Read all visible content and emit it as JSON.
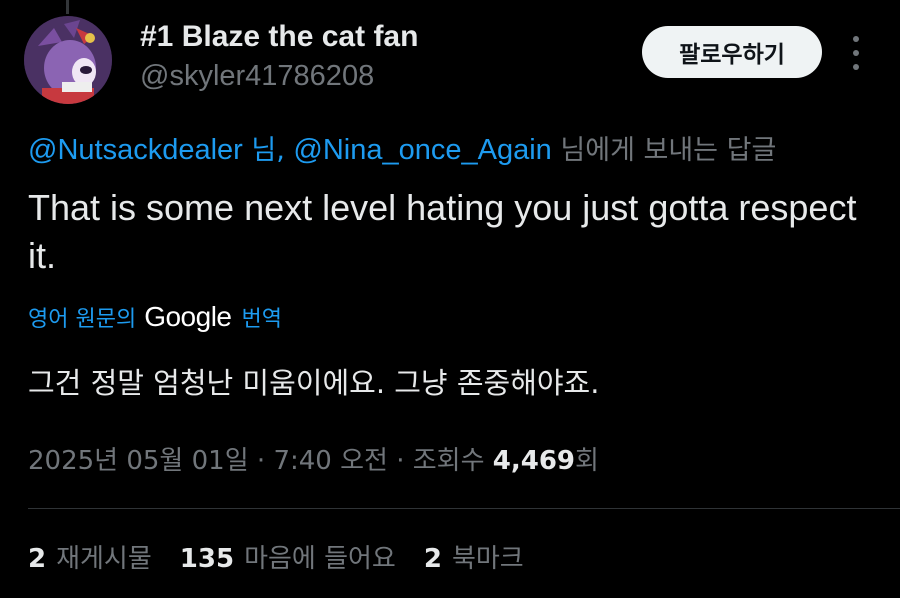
{
  "author": {
    "display_name": "#1 Blaze the cat fan",
    "handle": "@skyler41786208"
  },
  "header": {
    "follow_label": "팔로우하기",
    "more_icon": "more-vertical-icon"
  },
  "reply": {
    "mention1": "@Nutsackdealer",
    "suffix1": " 님, ",
    "mention2": "@Nina_once_Again",
    "suffix2": " 님에게 보내는 답글"
  },
  "tweet": {
    "text": "That is some next level hating you just gotta respect it."
  },
  "translation": {
    "prefix": "영어 원문의",
    "google": "Google",
    "suffix": "번역",
    "text": "그건 정말 엄청난 미움이에요. 그냥 존중해야죠."
  },
  "meta": {
    "date": "2025년 05월 01일",
    "sep1": " · ",
    "time": "7:40 오전",
    "sep2": " · ",
    "views_label": "조회수 ",
    "views_count": "4,469",
    "views_suffix": "회"
  },
  "stats": [
    {
      "count": "2",
      "label": "재게시물"
    },
    {
      "count": "135",
      "label": "마음에 들어요"
    },
    {
      "count": "2",
      "label": "북마크"
    }
  ],
  "colors": {
    "background": "#000000",
    "text": "#e7e9ea",
    "secondary": "#71767b",
    "link": "#1d9bf0"
  }
}
